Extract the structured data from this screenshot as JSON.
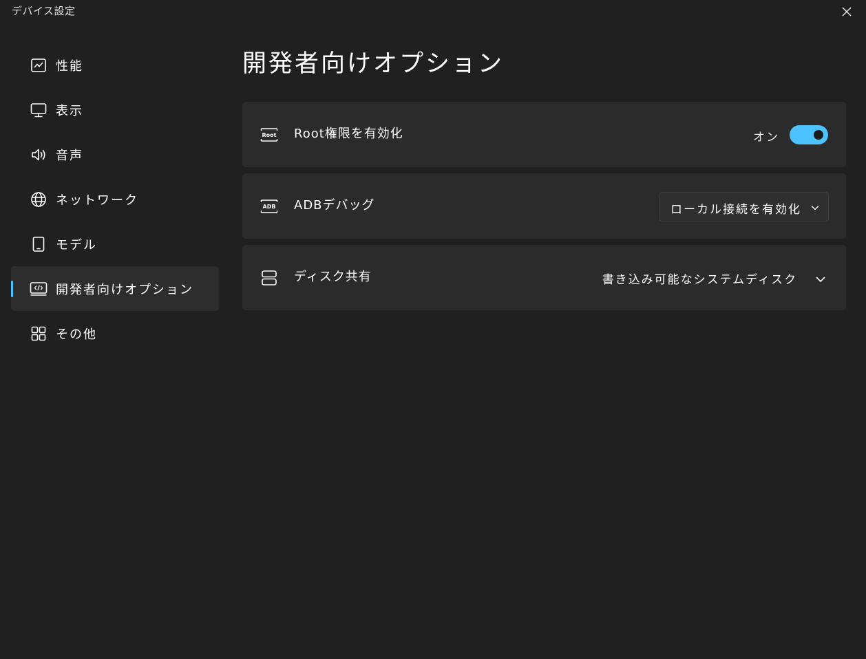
{
  "window": {
    "title": "デバイス設定"
  },
  "sidebar": {
    "items": [
      {
        "label": "性能",
        "icon": "performance-chart-icon"
      },
      {
        "label": "表示",
        "icon": "monitor-icon"
      },
      {
        "label": "音声",
        "icon": "speaker-icon"
      },
      {
        "label": "ネットワーク",
        "icon": "globe-icon"
      },
      {
        "label": "モデル",
        "icon": "tablet-icon"
      },
      {
        "label": "開発者向けオプション",
        "icon": "developer-code-icon",
        "active": true
      },
      {
        "label": "その他",
        "icon": "grid-apps-icon"
      }
    ]
  },
  "main": {
    "title": "開発者向けオプション",
    "cards": {
      "root": {
        "label": "Root権限を有効化",
        "icon_text": "Root",
        "toggle_state_label": "オン",
        "toggle_on": true
      },
      "adb": {
        "label": "ADBデバッグ",
        "icon_text": "ADB",
        "selected": "ローカル接続を有効化"
      },
      "disk": {
        "label": "ディスク共有",
        "icon": "storage-icon",
        "selected": "書き込み可能なシステムディスク"
      }
    }
  },
  "colors": {
    "background": "#202020",
    "card": "#2b2b2b",
    "active_item": "#2d2d2d",
    "accent": "#4cc2ff"
  }
}
